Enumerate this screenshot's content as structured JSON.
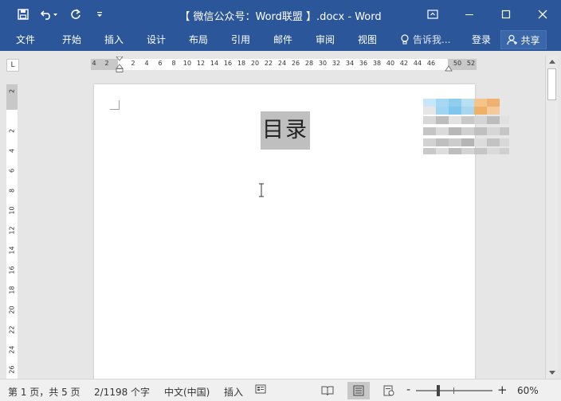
{
  "title_bar": {
    "title": "【 微信公众号：Word联盟 】.docx - Word",
    "qat_icons": [
      "save-icon",
      "undo-icon",
      "redo-icon",
      "customize-qat-icon"
    ]
  },
  "ribbon": {
    "tabs": [
      "文件",
      "开始",
      "插入",
      "设计",
      "布局",
      "引用",
      "邮件",
      "审阅",
      "视图"
    ],
    "tell_me": "告诉我...",
    "login": "登录",
    "share": "共享"
  },
  "ruler": {
    "tab_selector": "L",
    "horizontal_numbers": [
      "4",
      "2",
      "2",
      "4",
      "6",
      "8",
      "10",
      "12",
      "14",
      "16",
      "18",
      "20",
      "22",
      "24",
      "26",
      "28",
      "30",
      "32",
      "34",
      "36",
      "38",
      "40",
      "42",
      "44",
      "46",
      "50",
      "52"
    ],
    "vertical_numbers": [
      "2",
      "2",
      "4",
      "6",
      "8",
      "10",
      "12",
      "14",
      "16",
      "18",
      "20",
      "22",
      "24",
      "26"
    ]
  },
  "document": {
    "heading": "目录"
  },
  "status_bar": {
    "page": "第 1 页，共 5 页",
    "words": "2/1198 个字",
    "language": "中文(中国)",
    "mode": "插入",
    "zoom": "60%",
    "zoom_minus": "-",
    "zoom_plus": "+"
  },
  "colors": {
    "accent": "#2b579a",
    "canvas": "#e6e6e6",
    "heading_highlight": "#bfbfbf"
  }
}
